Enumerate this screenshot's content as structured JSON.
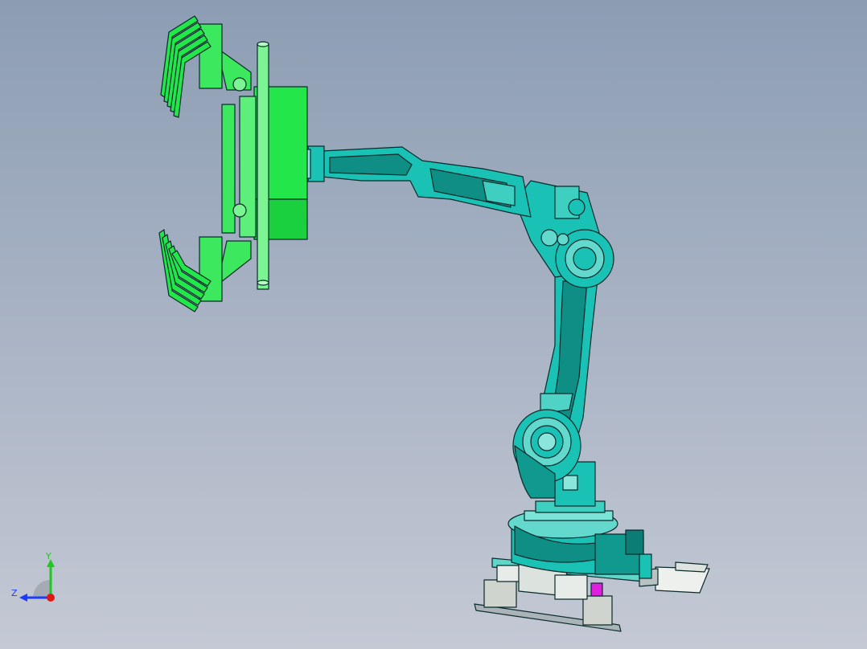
{
  "viewport": {
    "background_top": "#8c9db3",
    "background_bottom": "#c4c9d4"
  },
  "model": {
    "gripper_color": "#22e64a",
    "arm_color": "#19c2b4",
    "arm_dark": "#0f8e86",
    "outline_color": "#0b2a2a",
    "highlight_color": "#e01ee0"
  },
  "triad": {
    "y_label": "Y",
    "z_label": "Z",
    "y_color": "#1ec81e",
    "z_color": "#1e3cff",
    "x_color": "#e01818"
  }
}
